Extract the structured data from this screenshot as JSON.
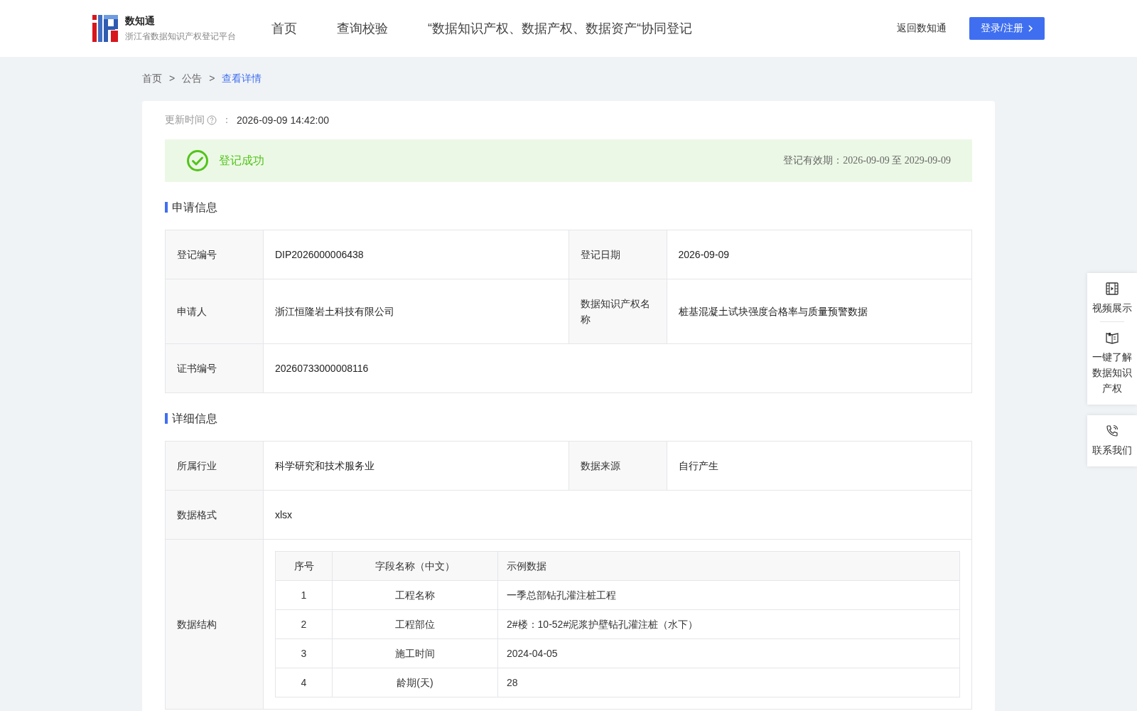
{
  "header": {
    "logo": {
      "name": "数知通",
      "subtitle": "浙江省数据知识产权登记平台"
    },
    "nav": [
      {
        "label": "首页",
        "selected": false
      },
      {
        "label": "查询校验",
        "selected": false
      },
      {
        "label": "“数据知识产权、数据产权、数据资产“协同登记",
        "selected": false
      }
    ],
    "back_link": "返回数知通",
    "login_button": "登录/注册"
  },
  "breadcrumb": [
    {
      "label": "首页",
      "current": false
    },
    {
      "label": "公告",
      "current": false
    },
    {
      "label": "查看详情",
      "current": true
    }
  ],
  "breadcrumb_separator": ">",
  "update_time": {
    "label": "更新时间",
    "separator": "：",
    "value": "2026-09-09 14:42:00"
  },
  "status": {
    "text": "登记成功",
    "validity": "登记有效期：2026-09-09 至 2029-09-09"
  },
  "sections": [
    {
      "title": "申请信息",
      "rows": [
        [
          {
            "label": "登记编号",
            "kind": "text",
            "value": "DIP2026000006438"
          },
          {
            "label": "登记日期",
            "kind": "text",
            "value": "2026-09-09"
          }
        ],
        [
          {
            "label": "申请人",
            "kind": "text",
            "value": "浙江恒隆岩土科技有限公司"
          },
          {
            "label": "数据知识产权名称",
            "kind": "text",
            "value": "桩基混凝土试块强度合格率与质量预警数据"
          }
        ],
        [
          {
            "label": "证书编号",
            "kind": "text",
            "value": "20260733000008116"
          }
        ]
      ]
    },
    {
      "title": "详细信息",
      "rows": [
        [
          {
            "label": "所属行业",
            "kind": "text",
            "value": "科学研究和技术服务业"
          },
          {
            "label": "数据来源",
            "kind": "text",
            "value": "自行产生"
          }
        ],
        [
          {
            "label": "数据格式",
            "kind": "text",
            "value": "xlsx"
          }
        ],
        [
          {
            "label": "数据结构",
            "kind": "table",
            "columns": [
              "序号",
              "字段名称（中文）",
              "示例数据"
            ],
            "rows": [
              [
                "1",
                "工程名称",
                "一季总部钻孔灌注桩工程"
              ],
              [
                "2",
                "工程部位",
                "2#楼：10-52#泥浆护壁钻孔灌注桩（水下）"
              ],
              [
                "3",
                "施工时间",
                "2024-04-05"
              ],
              [
                "4",
                "龄期(天)",
                "28"
              ]
            ]
          }
        ]
      ]
    }
  ],
  "side_panel": [
    [
      {
        "kind": "video",
        "label": "视频展示"
      },
      {
        "kind": "book",
        "label": "一键了解数据知识产权"
      }
    ],
    [
      {
        "kind": "phone",
        "label": "联系我们"
      }
    ]
  ]
}
